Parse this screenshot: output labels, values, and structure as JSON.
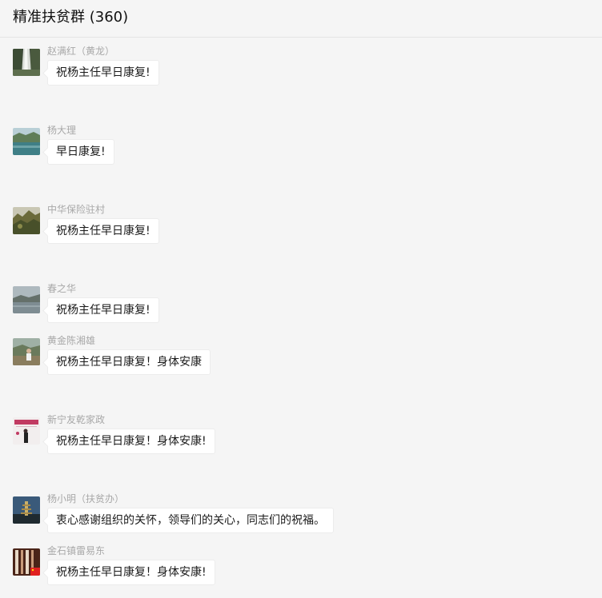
{
  "chat": {
    "title": "精准扶贫群 (360)"
  },
  "messages": [
    {
      "sender": "赵满红（黄龙）",
      "text": "祝杨主任早日康复!",
      "avatar": "waterfall-avatar"
    },
    {
      "sender": "杨大理",
      "text": "早日康复!",
      "avatar": "lake-avatar"
    },
    {
      "sender": "中华保险驻村",
      "text": "祝杨主任早日康复!",
      "avatar": "hills-avatar"
    },
    {
      "sender": "春之华",
      "text": "祝杨主任早日康复!",
      "avatar": "misty-lake-avatar"
    },
    {
      "sender": "黄金陈湘雄",
      "text": "祝杨主任早日康复！身体安康",
      "avatar": "person-outdoors-avatar"
    },
    {
      "sender": "新宁友乾家政",
      "text": "祝杨主任早日康复！身体安康!",
      "avatar": "agency-logo-avatar"
    },
    {
      "sender": "杨小明（扶贫办）",
      "text": "衷心感谢组织的关怀，领导们的关心，同志们的祝福。",
      "avatar": "pagoda-avatar"
    },
    {
      "sender": "金石镇雷易东",
      "text": "祝杨主任早日康复！身体安康!",
      "avatar": "flag-avatar"
    }
  ]
}
